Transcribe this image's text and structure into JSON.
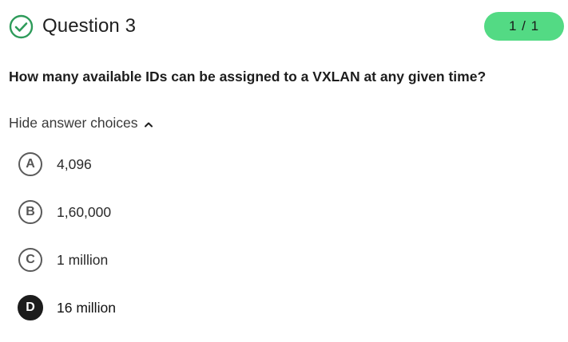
{
  "question": {
    "title": "Question 3",
    "score": "1 / 1",
    "status_icon": "check-circle-icon",
    "prompt": "How many available IDs can be assigned to a VXLAN at any given time?"
  },
  "toggle": {
    "label": "Hide answer choices",
    "icon": "chevron-up-icon"
  },
  "choices": [
    {
      "letter": "A",
      "text": "4,096",
      "selected": false
    },
    {
      "letter": "B",
      "text": "1,60,000",
      "selected": false
    },
    {
      "letter": "C",
      "text": "1 million",
      "selected": false
    },
    {
      "letter": "D",
      "text": "16 million",
      "selected": true
    }
  ],
  "colors": {
    "correct_green": "#2e9b5a",
    "badge_green": "#53da84",
    "selected_dark": "#1c1c1c"
  }
}
